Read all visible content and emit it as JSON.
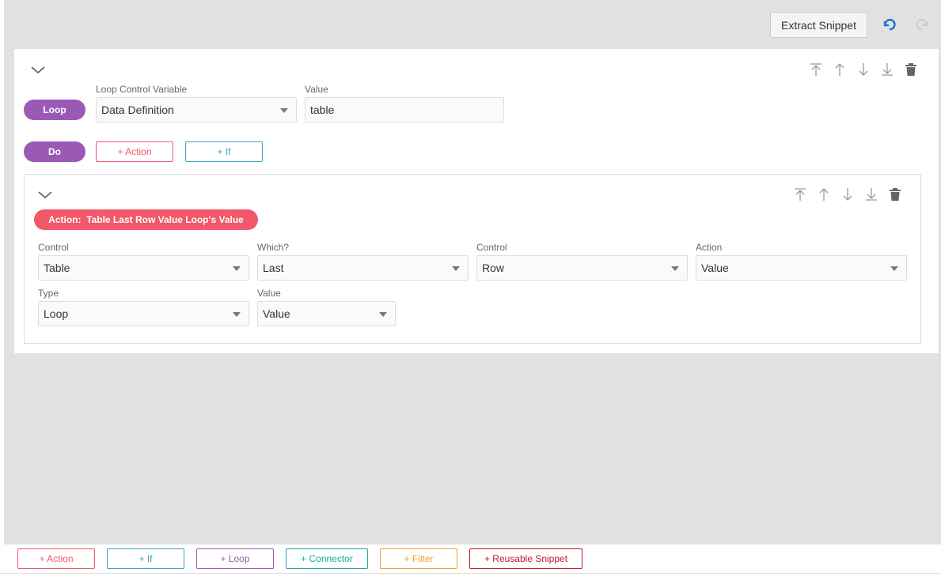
{
  "topbar": {
    "extract_label": "Extract Snippet"
  },
  "loop": {
    "pill": "Loop",
    "var_label": "Loop Control Variable",
    "var_value": "Data Definition",
    "value_label": "Value",
    "value_value": "table"
  },
  "do": {
    "pill": "Do",
    "add_action": "+ Action",
    "add_if": "+ If"
  },
  "action": {
    "pill": "Action:  Table Last Row Value Loop's Value",
    "fields": [
      {
        "label": "Control",
        "value": "Table"
      },
      {
        "label": "Which?",
        "value": "Last"
      },
      {
        "label": "Control",
        "value": "Row"
      },
      {
        "label": "Action",
        "value": "Value"
      },
      {
        "label": "Type",
        "value": "Loop"
      },
      {
        "label": "Value",
        "value": "Value"
      }
    ]
  },
  "bottom": {
    "buttons": [
      "+ Action",
      "+ If",
      "+ Loop",
      "+ Connector",
      "+ Filter",
      "+ Reusable Snippet"
    ]
  },
  "colors": {
    "loop_purple": "#9b59b6",
    "action_red": "#f2576a",
    "if_blue": "#3fa3c4",
    "connector_teal": "#1aaa9e",
    "filter_orange": "#f0a030",
    "snippet_darkred": "#c0182a",
    "undo_blue": "#1a73c8"
  },
  "icons": [
    "undo-icon",
    "redo-icon",
    "chevron-down-icon",
    "move-top-icon",
    "move-up-icon",
    "move-down-icon",
    "move-bottom-icon",
    "trash-icon"
  ]
}
